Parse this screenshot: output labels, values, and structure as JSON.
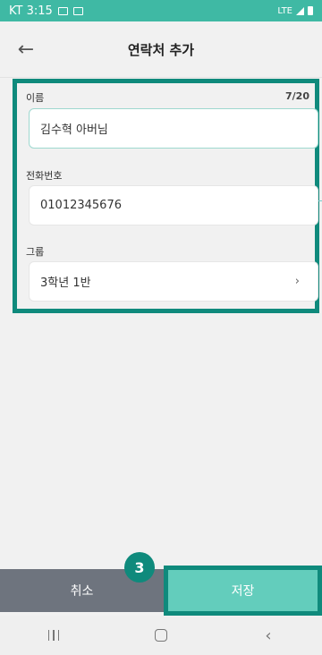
{
  "status_bar": {
    "time": "KT 3:15",
    "network": "LTE"
  },
  "header": {
    "title": "연락처 추가",
    "back_icon": "←"
  },
  "form": {
    "name": {
      "label": "이름",
      "value": "김수혁 아버님",
      "counter": "7/20"
    },
    "phone": {
      "label": "전화번호",
      "value": "01012345676"
    },
    "group": {
      "label": "그룹",
      "value": "3학년 1반",
      "chevron": "›"
    }
  },
  "footer": {
    "cancel_label": "취소",
    "save_label": "저장",
    "step_number": "3"
  },
  "nav": {
    "back_glyph": "‹"
  },
  "colors": {
    "accent": "#3fb9a4",
    "highlight_border": "#0f8a7c",
    "save_button": "#63cdbc",
    "cancel_button": "#6e747e"
  }
}
